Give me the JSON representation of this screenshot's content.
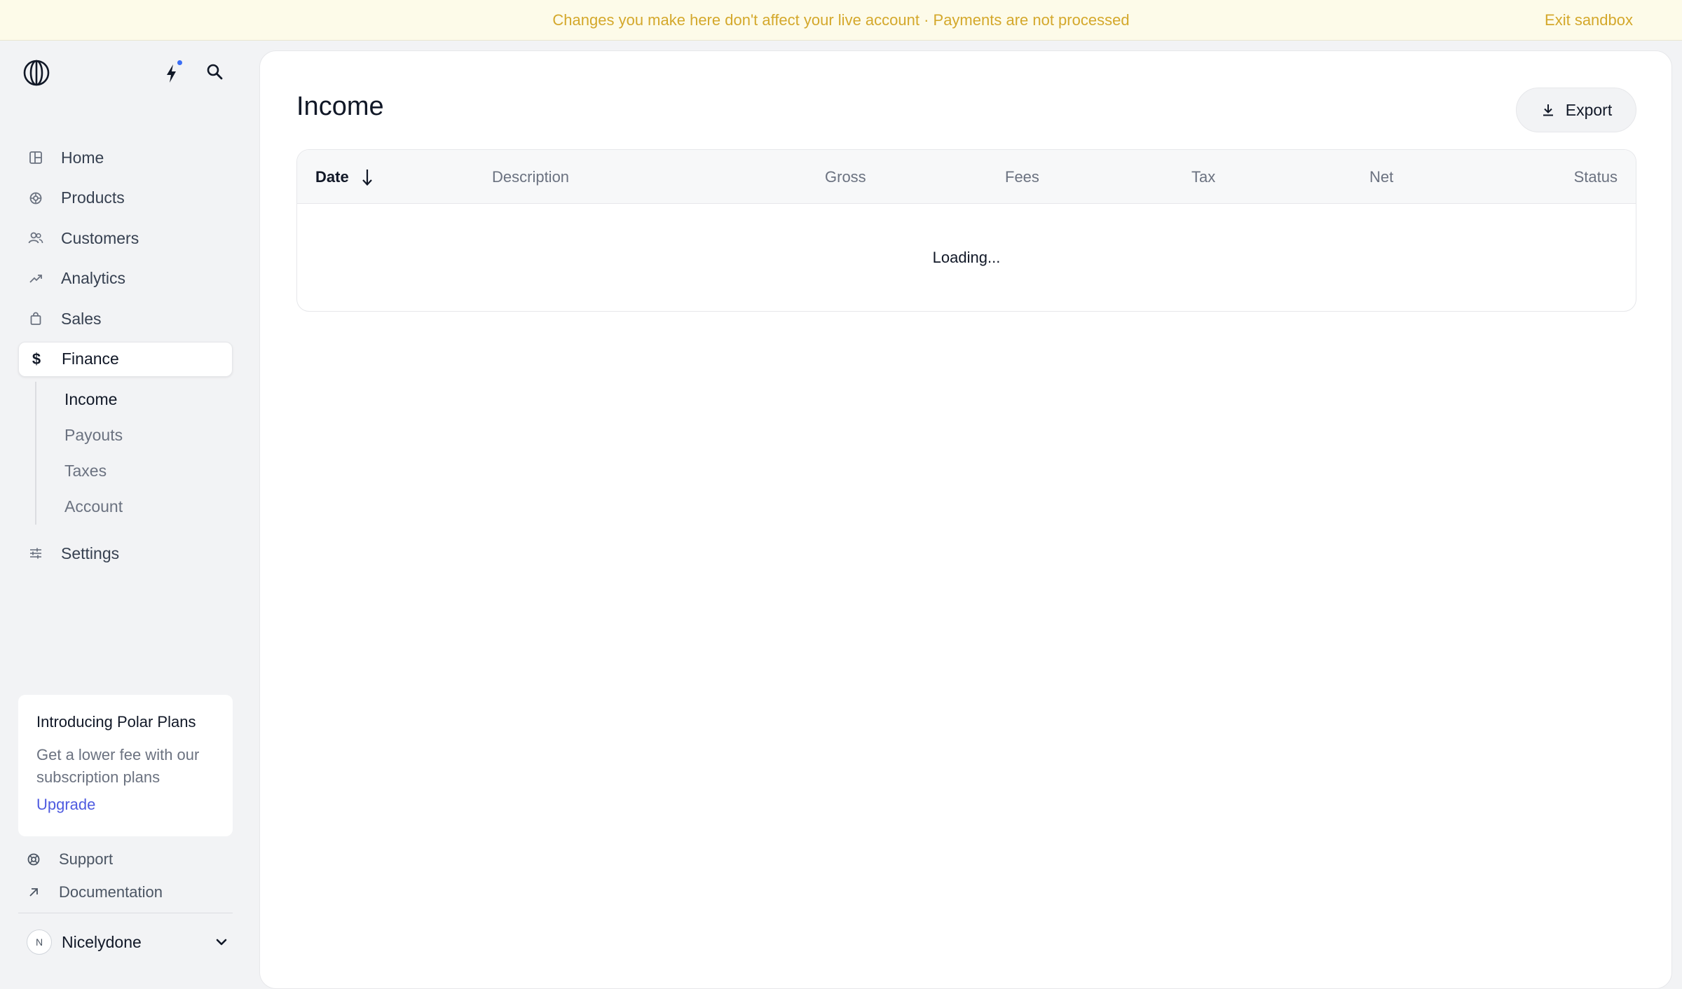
{
  "banner": {
    "message": "Changes you make here don't affect your live account · Payments are not processed",
    "exit_label": "Exit sandbox"
  },
  "sidebar": {
    "items": [
      {
        "label": "Home",
        "icon": "home-icon"
      },
      {
        "label": "Products",
        "icon": "products-icon"
      },
      {
        "label": "Customers",
        "icon": "customers-icon"
      },
      {
        "label": "Analytics",
        "icon": "analytics-icon"
      },
      {
        "label": "Sales",
        "icon": "sales-icon"
      },
      {
        "label": "Finance",
        "icon": "dollar-icon",
        "active": true
      }
    ],
    "finance_sub": [
      {
        "label": "Income",
        "active": true
      },
      {
        "label": "Payouts"
      },
      {
        "label": "Taxes"
      },
      {
        "label": "Account"
      }
    ],
    "settings": {
      "label": "Settings",
      "icon": "settings-icon"
    },
    "promo": {
      "title": "Introducing Polar Plans",
      "description": "Get a lower fee with our subscription plans",
      "link": "Upgrade"
    },
    "support_label": "Support",
    "documentation_label": "Documentation",
    "user": {
      "initial": "N",
      "name": "Nicelydone"
    }
  },
  "main": {
    "title": "Income",
    "export_label": "Export",
    "table": {
      "columns": [
        "Date",
        "Description",
        "Gross",
        "Fees",
        "Tax",
        "Net",
        "Status"
      ],
      "loading_text": "Loading..."
    }
  },
  "colors": {
    "banner_text": "#d4a82b",
    "banner_bg": "#fdfbe9",
    "accent_link": "#4f5be0",
    "notification_dot": "#3b6ef5"
  }
}
